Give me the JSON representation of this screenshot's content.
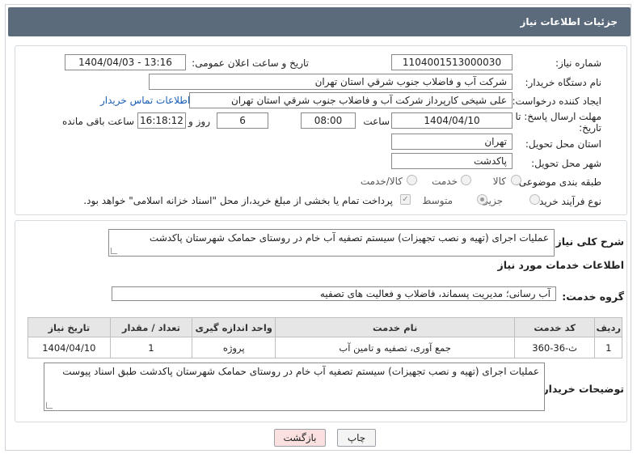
{
  "header": {
    "title": "جزئیات اطلاعات نیاز"
  },
  "fields": {
    "need_number_label": "شماره نیاز:",
    "need_number": "1104001513000030",
    "announce_label": "تاریخ و ساعت اعلان عمومی:",
    "announce_value": "1404/04/03 - 13:16",
    "buyer_org_label": "نام دستگاه خریدار:",
    "buyer_org": "شرکت آب و فاضلاب جنوب شرقي استان تهران",
    "creator_label": "ایجاد کننده درخواست:",
    "creator": "علی شیخی کارپرداز شرکت آب و فاضلاب جنوب شرقي استان تهران",
    "contact_link": "اطلاعات تماس خریدار",
    "deadline_label_1": "مهلت ارسال پاسخ: تا",
    "deadline_label_2": "تاریخ:",
    "deadline_date": "1404/04/10",
    "time_label": "ساعت",
    "deadline_time": "08:00",
    "days_value": "6",
    "days_label": "روز و",
    "remaining_time": "16:18:12",
    "remaining_label": "ساعت باقی مانده",
    "province_label": "استان محل تحویل:",
    "province": "تهران",
    "city_label": "شهر محل تحویل:",
    "city": "پاکدشت",
    "category_label": "طبقه بندی موضوعی:",
    "category_options": [
      "کالا",
      "خدمت",
      "کالا/خدمت"
    ],
    "process_label": "نوع فرآیند خرید :",
    "process_options": [
      "جزیی",
      "متوسط"
    ],
    "payment_note": "پرداخت تمام یا بخشی از مبلغ خرید،از محل \"اسناد خزانه اسلامی\" خواهد بود."
  },
  "summary": {
    "label": "شرح کلی نیاز:",
    "text": "عملیات اجرای (تهیه و نصب تجهیزات) سیستم تصفیه آب خام در روستای حمامک شهرستان پاکدشت"
  },
  "services": {
    "section_title": "اطلاعات خدمات مورد نیاز",
    "group_label": "گروه خدمت:",
    "group_value": "آب رسانی؛ مدیریت پسماند، فاضلاب و فعالیت های تصفیه",
    "columns": [
      "ردیف",
      "کد خدمت",
      "نام خدمت",
      "واحد اندازه گیری",
      "تعداد / مقدار",
      "تاریخ نیاز"
    ],
    "rows": [
      [
        "1",
        "ث-36-360",
        "جمع آوری، تصفیه و تامین آب",
        "پروژه",
        "1",
        "1404/04/10"
      ]
    ]
  },
  "buyer_notes": {
    "label": "توضیحات خریدار:",
    "text": "عملیات اجرای (تهیه و نصب تجهیزات) سیستم تصفیه آب خام در روستای حمامک شهرستان پاکدشت طبق اسناد پیوست"
  },
  "buttons": {
    "print": "چاپ",
    "back": "بازگشت"
  },
  "colors": {
    "header_bg": "#5c6b7b",
    "link": "#1a5fb4",
    "back_button_bg": "#fbe0e0",
    "watermark": "#c0392b"
  }
}
